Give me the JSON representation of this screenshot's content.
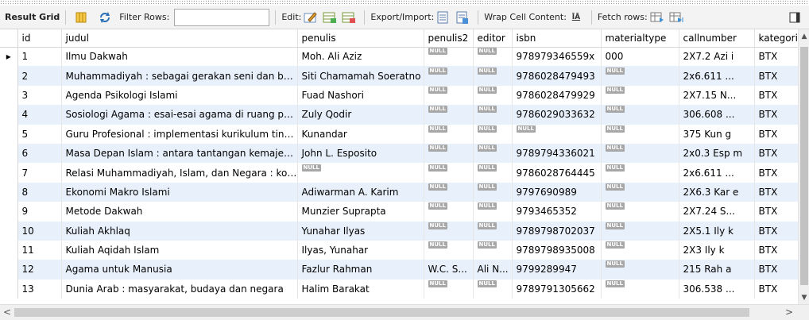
{
  "toolbar": {
    "result_grid_label": "Result Grid",
    "filter_rows_label": "Filter Rows:",
    "filter_value": "",
    "edit_label": "Edit:",
    "export_import_label": "Export/Import:",
    "wrap_cell_label": "Wrap Cell Content:",
    "wrap_icon_text": "ĪĀ",
    "fetch_rows_label": "Fetch rows:"
  },
  "grid": {
    "null_text": "NULL",
    "columns": [
      "id",
      "judul",
      "penulis",
      "penulis2",
      "editor",
      "isbn",
      "materialtype",
      "callnumber",
      "kategori"
    ],
    "rows": [
      {
        "id": "1",
        "judul": "Ilmu Dakwah",
        "penulis": "Moh. Ali Aziz",
        "penulis2": null,
        "editor": null,
        "isbn": "978979346559x",
        "materialtype": "000",
        "callnumber": "2X7.2 Azi i",
        "kategori": "BTX"
      },
      {
        "id": "2",
        "judul": "Muhammadiyah : sebagai gerakan seni dan bud...",
        "penulis": "Siti Chamamah Soeratno",
        "penulis2": null,
        "editor": null,
        "isbn": "9786028479493",
        "materialtype": null,
        "callnumber": "2x6.611 ...",
        "kategori": "BTX"
      },
      {
        "id": "3",
        "judul": "Agenda Psikologi Islami",
        "penulis": "Fuad Nashori",
        "penulis2": null,
        "editor": null,
        "isbn": "9786028479929",
        "materialtype": null,
        "callnumber": "2X7.15 N...",
        "kategori": "BTX"
      },
      {
        "id": "4",
        "judul": "Sosiologi Agama : esai-esai agama di ruang publik",
        "penulis": "Zuly Qodir",
        "penulis2": null,
        "editor": null,
        "isbn": "9786029033632",
        "materialtype": null,
        "callnumber": "306.608 ...",
        "kategori": "BTX"
      },
      {
        "id": "5",
        "judul": "Guru Profesional : implementasi kurikulum tingka...",
        "penulis": "Kunandar",
        "penulis2": null,
        "editor": null,
        "isbn": null,
        "materialtype": null,
        "callnumber": "375 Kun g",
        "kategori": "BTX"
      },
      {
        "id": "6",
        "judul": "Masa Depan Islam : antara tantangan kemajem...",
        "penulis": "John L. Esposito",
        "penulis2": null,
        "editor": null,
        "isbn": "9789794336021",
        "materialtype": null,
        "callnumber": "2x0.3 Esp m",
        "kategori": "BTX"
      },
      {
        "id": "7",
        "judul": "Relasi Muhammadiyah, Islam, dan Negara : kon...",
        "penulis": null,
        "penulis2": null,
        "editor": null,
        "isbn": "9786028764445",
        "materialtype": null,
        "callnumber": "2x6.611 ...",
        "kategori": "BTX"
      },
      {
        "id": "8",
        "judul": "Ekonomi Makro Islami",
        "penulis": "Adiwarman A. Karim",
        "penulis2": null,
        "editor": null,
        "isbn": "9797690989",
        "materialtype": null,
        "callnumber": "2X6.3 Kar e",
        "kategori": "BTX"
      },
      {
        "id": "9",
        "judul": "Metode Dakwah",
        "penulis": "Munzier Suprapta",
        "penulis2": null,
        "editor": null,
        "isbn": "9793465352",
        "materialtype": null,
        "callnumber": "2X7.24 S...",
        "kategori": "BTX"
      },
      {
        "id": "10",
        "judul": "Kuliah Akhlaq",
        "penulis": "Yunahar Ilyas",
        "penulis2": null,
        "editor": null,
        "isbn": "9789798702037",
        "materialtype": null,
        "callnumber": "2X5.1 Ily k",
        "kategori": "BTX"
      },
      {
        "id": "11",
        "judul": "Kuliah Aqidah Islam",
        "penulis": "Ilyas, Yunahar",
        "penulis2": null,
        "editor": null,
        "isbn": "9789798935008",
        "materialtype": null,
        "callnumber": "2X3 Ily k",
        "kategori": "BTX"
      },
      {
        "id": "12",
        "judul": "Agama untuk Manusia",
        "penulis": "Fazlur Rahman",
        "penulis2": "W.C. S...",
        "editor": "Ali N...",
        "isbn": "9799289947",
        "materialtype": null,
        "callnumber": "215 Rah a",
        "kategori": "BTX"
      },
      {
        "id": "13",
        "judul": "Dunia Arab : masyarakat, budaya dan negara",
        "penulis": "Halim Barakat",
        "penulis2": null,
        "editor": null,
        "isbn": "9789791305662",
        "materialtype": null,
        "callnumber": "306.538 ...",
        "kategori": "BTX"
      }
    ],
    "selected_row_marker": "▸"
  },
  "colors": {
    "row_alt": "#e8f1fb",
    "toolbar_bg": "#f3f3f3",
    "null_badge": "#a7a7a7"
  }
}
